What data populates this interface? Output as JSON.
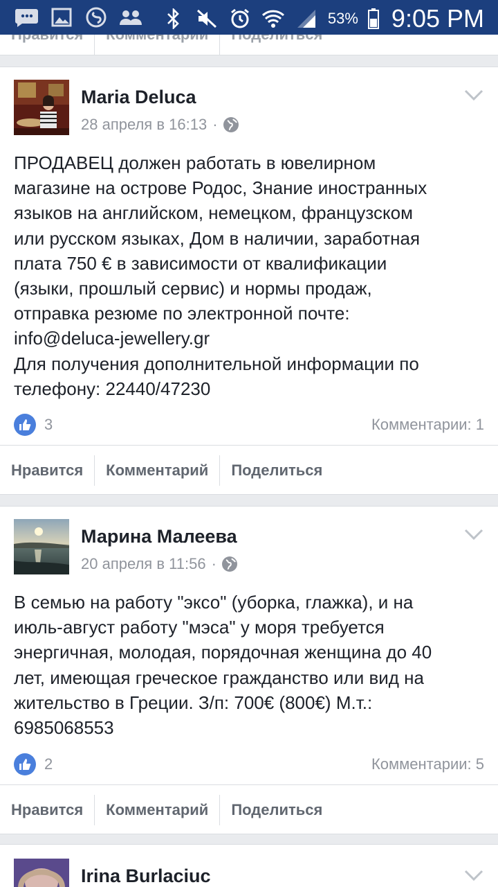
{
  "status_bar": {
    "battery_percent": "53%",
    "time": "9:05 PM",
    "icons": [
      "chat-icon",
      "gallery-icon",
      "shazam-icon",
      "contacts-icon",
      "bluetooth-icon",
      "mute-icon",
      "alarm-icon",
      "wifi-icon",
      "signal-icon",
      "battery-icon"
    ]
  },
  "prev_post": {
    "actions": [
      "Нравится",
      "Комментарий",
      "Поделиться"
    ]
  },
  "posts": [
    {
      "author": "Maria Deluca",
      "timestamp": "28 апреля в 16:13",
      "separator": "·",
      "body_lines": [
        "ПРОДАВЕЦ должен работать в ювелирном",
        "магазине на острове Родос, Знание иностранных",
        "языков на английском, немецком, французском",
        "или русском языках, Дом в наличии, заработная",
        "плата 750 € в зависимости от квалификации",
        "(языки, прошлый сервис) и нормы продаж,",
        "отправка резюме по электронной почте:",
        "info@deluca-jewellery.gr",
        "Для получения дополнительной информации по",
        "телефону: 22440/47230"
      ],
      "likes": "3",
      "comments": "Комментарии: 1",
      "actions": {
        "like": "Нравится",
        "comment": "Комментарий",
        "share": "Поделиться"
      }
    },
    {
      "author": "Марина Малеева",
      "timestamp": "20 апреля в 11:56",
      "separator": "·",
      "body_lines": [
        "В семью на работу \"эксо\" (уборка, глажка), и на",
        "июль-август работу \"мэса\" у моря требуется",
        "энергичная, молодая, порядочная женщина до 40",
        "лет, имеющая греческое гражданство или вид на",
        "жительство в Греции. З/п: 700€ (800€) М.т.:",
        "6985068553"
      ],
      "likes": "2",
      "comments": "Комментарии: 5",
      "actions": {
        "like": "Нравится",
        "comment": "Комментарий",
        "share": "Поделиться"
      }
    },
    {
      "author": "Irina Burlaciuc"
    }
  ],
  "colors": {
    "status_bar": "#1c3f7e",
    "like_blue": "#4a7fdc",
    "meta_gray": "#90949c",
    "feed_bg": "#e9ebee"
  }
}
